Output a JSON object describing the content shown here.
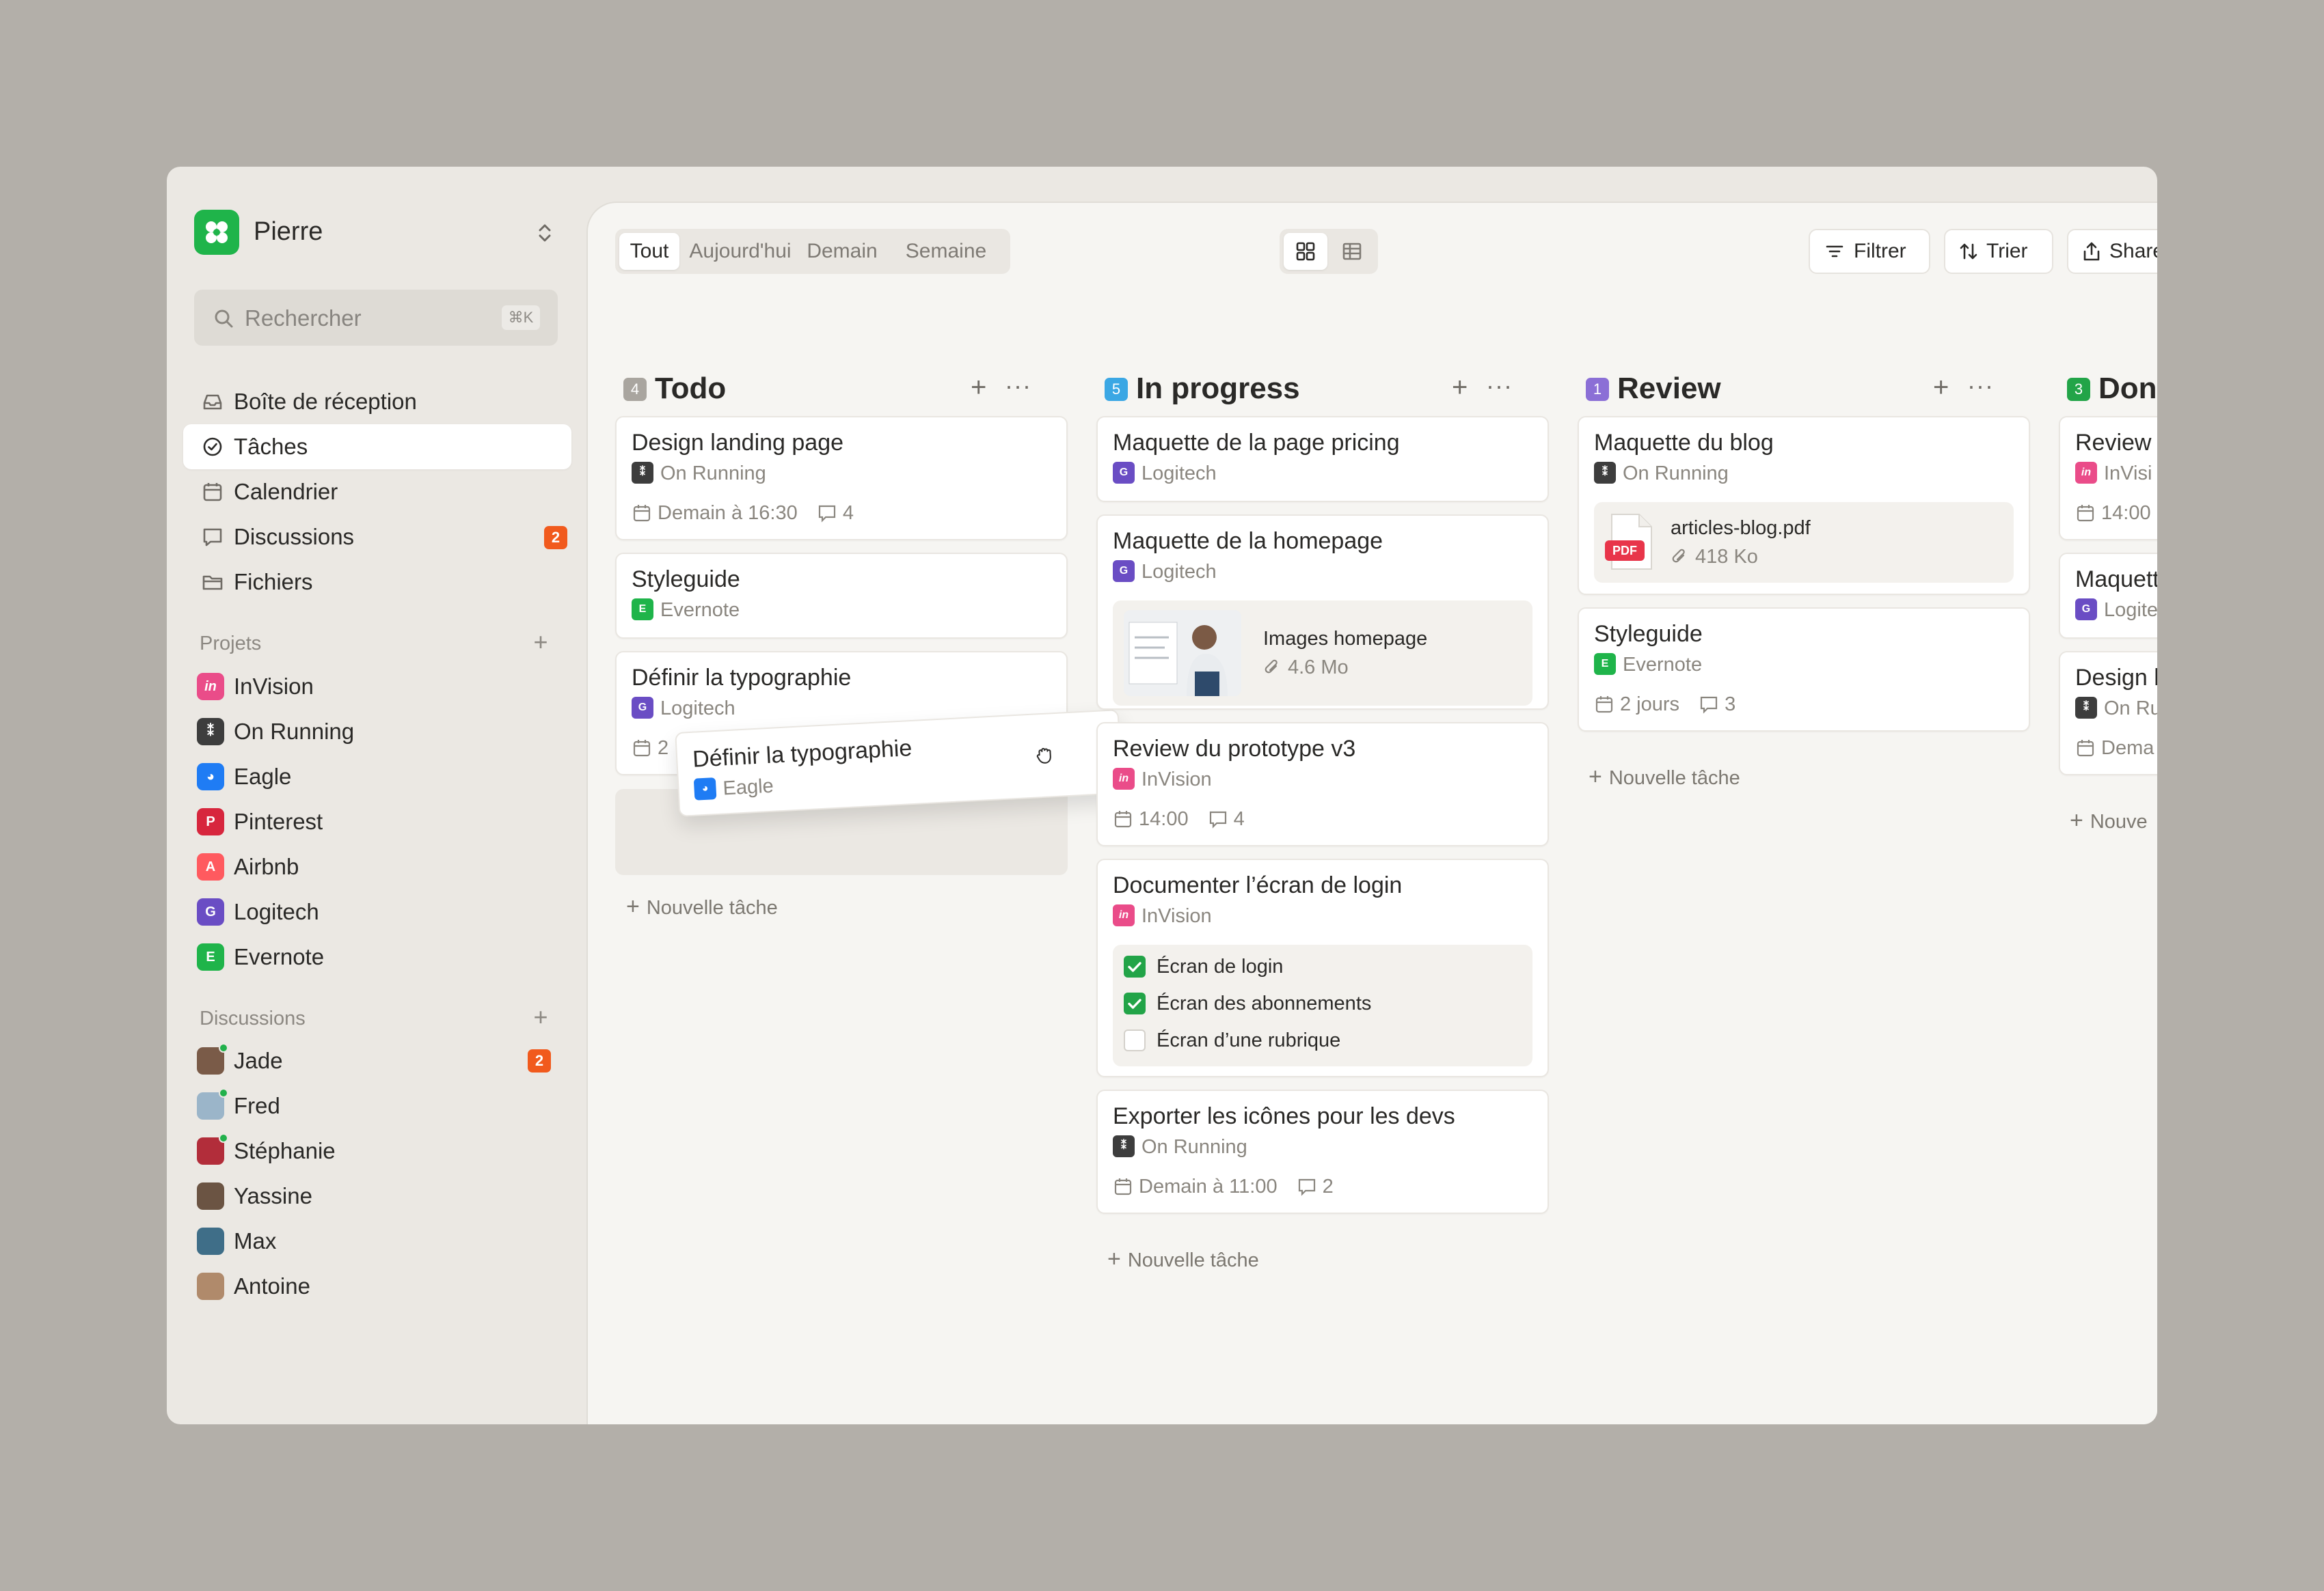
{
  "workspace": {
    "name": "Pierre",
    "logo_color": "#1fb44a"
  },
  "search": {
    "placeholder": "Rechercher",
    "shortcut": "⌘K"
  },
  "nav": [
    {
      "label": "Boîte de réception",
      "icon": "inbox-icon"
    },
    {
      "label": "Tâches",
      "icon": "check-circle-icon",
      "active": true
    },
    {
      "label": "Calendrier",
      "icon": "calendar-icon"
    },
    {
      "label": "Discussions",
      "icon": "chat-icon",
      "badge": "2"
    },
    {
      "label": "Fichiers",
      "icon": "folder-icon"
    }
  ],
  "projects": {
    "title": "Projets",
    "items": [
      {
        "label": "InVision",
        "color": "#ea4c89",
        "glyph": "in"
      },
      {
        "label": "On Running",
        "color": "#3d3d3d",
        "glyph": "⁑"
      },
      {
        "label": "Eagle",
        "color": "#1f7cf4",
        "glyph": "◕"
      },
      {
        "label": "Pinterest",
        "color": "#d7263d",
        "glyph": "P"
      },
      {
        "label": "Airbnb",
        "color": "#ff5a5f",
        "glyph": "A"
      },
      {
        "label": "Logitech",
        "color": "#6a4dc4",
        "glyph": "G"
      },
      {
        "label": "Evernote",
        "color": "#1fb44a",
        "glyph": "E"
      }
    ]
  },
  "discussions": {
    "title": "Discussions",
    "items": [
      {
        "label": "Jade",
        "badge": "2",
        "online": true,
        "color": "#7a5b48"
      },
      {
        "label": "Fred",
        "online": true,
        "color": "#9bb5c9"
      },
      {
        "label": "Stéphanie",
        "online": true,
        "color": "#b22d3a"
      },
      {
        "label": "Yassine",
        "color": "#6b5443"
      },
      {
        "label": "Max",
        "color": "#3f6e88"
      },
      {
        "label": "Antoine",
        "color": "#b08a6b"
      }
    ]
  },
  "toolbar": {
    "tabs": [
      "Tout",
      "Aujourd'hui",
      "Demain",
      "Semaine"
    ],
    "active_tab": "Tout",
    "filter": "Filtrer",
    "sort": "Trier",
    "share": "Share"
  },
  "columns": {
    "todo": {
      "title": "Todo",
      "count": "4",
      "color": "#a9a59f"
    },
    "progress": {
      "title": "In progress",
      "count": "5",
      "color": "#3ba7e4"
    },
    "review": {
      "title": "Review",
      "count": "1",
      "color": "#8b6fd6"
    },
    "done": {
      "title": "Don",
      "count": "3",
      "color": "#22a448"
    }
  },
  "new_task": "Nouvelle tâche",
  "cards": {
    "t1": {
      "title": "Design landing page",
      "project": "On Running",
      "due": "Demain à 16:30",
      "comments": "4"
    },
    "t2": {
      "title": "Styleguide",
      "project": "Evernote"
    },
    "t3": {
      "title": "Définir la typographie",
      "project": "Logitech",
      "due": "2"
    },
    "drag": {
      "title": "Définir la typographie",
      "project": "Eagle"
    },
    "p1": {
      "title": "Maquette de la page pricing",
      "project": "Logitech"
    },
    "p2": {
      "title": "Maquette de la homepage",
      "project": "Logitech",
      "file": "Images homepage",
      "size": "4.6 Mo"
    },
    "p3": {
      "title": "Review du prototype v3",
      "project": "InVision",
      "due": "14:00",
      "comments": "4"
    },
    "p4": {
      "title": "Documenter l’écran de login",
      "project": "InVision",
      "checklist": [
        {
          "label": "Écran de login",
          "done": true
        },
        {
          "label": "Écran des abonnements",
          "done": true
        },
        {
          "label": "Écran d’une rubrique",
          "done": false
        }
      ]
    },
    "p5": {
      "title": "Exporter les icônes pour les devs",
      "project": "On Running",
      "due": "Demain à 11:00",
      "comments": "2"
    },
    "r1": {
      "title": "Maquette du blog",
      "project": "On Running",
      "file": "articles-blog.pdf",
      "size": "418 Ko",
      "file_type": "PDF"
    },
    "r2": {
      "title": "Styleguide",
      "project": "Evernote",
      "due": "2 jours",
      "comments": "3"
    },
    "d1": {
      "title": "Review",
      "project": "InVisi",
      "due": "14:00"
    },
    "d2": {
      "title": "Maquett",
      "project": "Logite"
    },
    "d3": {
      "title": "Design l",
      "project": "On Ru",
      "due": "Dema"
    },
    "d_new": "Nouve"
  }
}
